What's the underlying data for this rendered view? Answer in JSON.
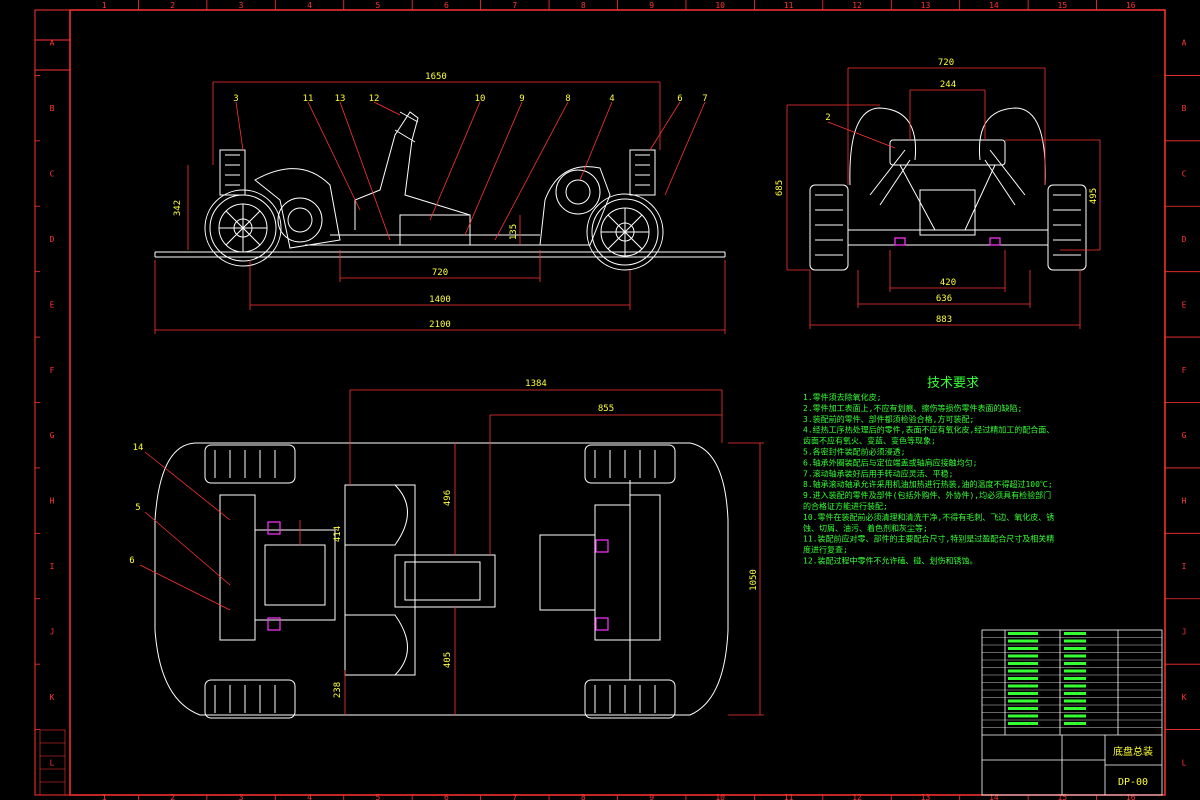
{
  "frame": {
    "columns": [
      "1",
      "2",
      "3",
      "4",
      "5",
      "6",
      "7",
      "8",
      "9",
      "10",
      "11",
      "12",
      "13",
      "14",
      "15",
      "16"
    ],
    "rows": [
      "A",
      "B",
      "C",
      "D",
      "E",
      "F",
      "G",
      "H",
      "I",
      "J",
      "K",
      "L"
    ]
  },
  "side_view": {
    "dim_overall_top": "1650",
    "dim_wheelbase": "1400",
    "dim_total_length": "2100",
    "dim_seat_base": "720",
    "dim_height": "342",
    "dim_seat_height": "135",
    "callouts": [
      "3",
      "11",
      "13",
      "12",
      "10",
      "9",
      "8",
      "4",
      "6",
      "7"
    ]
  },
  "front_view": {
    "dim_top": "720",
    "dim_inner": "244",
    "dim_left_height": "685",
    "dim_right_height": "495",
    "dim_420": "420",
    "dim_636": "636",
    "dim_883": "883",
    "callout": "2"
  },
  "top_view": {
    "dim_1384": "1384",
    "dim_855": "855",
    "dim_496": "496",
    "dim_414": "414",
    "dim_1050": "1050",
    "dim_405": "405",
    "dim_238": "238",
    "callouts": [
      "14",
      "5",
      "6"
    ]
  },
  "tech_requirements": {
    "title": "技术要求",
    "items": [
      "1.零件须去除氧化皮;",
      "2.零件加工表面上,不应有划痕、擦伤等损伤零件表面的缺陷;",
      "3.装配前的零件、部件都须检验合格,方可装配;",
      "4.经热工序热处理后的零件,表面不应有氧化皮,经过精加工的配合面、",
      "齿面不应有氧火、变蓝、变色等现象;",
      "5.各密封件装配前必须浸透;",
      "6.轴承外圈装配后与定位端盖或轴肩应接触均匀;",
      "7.滚动轴承装好后用手转动应灵活、平稳;",
      "8.轴承滚动轴承允许采用机油加热进行热装,油的温度不得超过100℃;",
      "9.进入装配的零件及部件(包括外购件、外协件),均必须具有检验部门",
      "的合格证方能进行装配;",
      "10.零件在装配前必须清理和清洗干净,不得有毛刺、飞边、氧化皮、锈",
      "蚀、切屑、油污、着色剂和灰尘等;",
      "11.装配前应对零、部件的主要配合尺寸,特别是过盈配合尺寸及相关精",
      "度进行复查;",
      "12.装配过程中零件不允许磕、碰、划伤和锈蚀。"
    ]
  },
  "title_block": {
    "drawing_name": "底盘总装",
    "drawing_number": "DP-00"
  },
  "colors": {
    "background": "#000000",
    "frame_red": "#ff3333",
    "drawing_white": "#ffffff",
    "text_green": "#33ff33",
    "dim_yellow": "#ffff33",
    "accent_magenta": "#ff33ff"
  }
}
